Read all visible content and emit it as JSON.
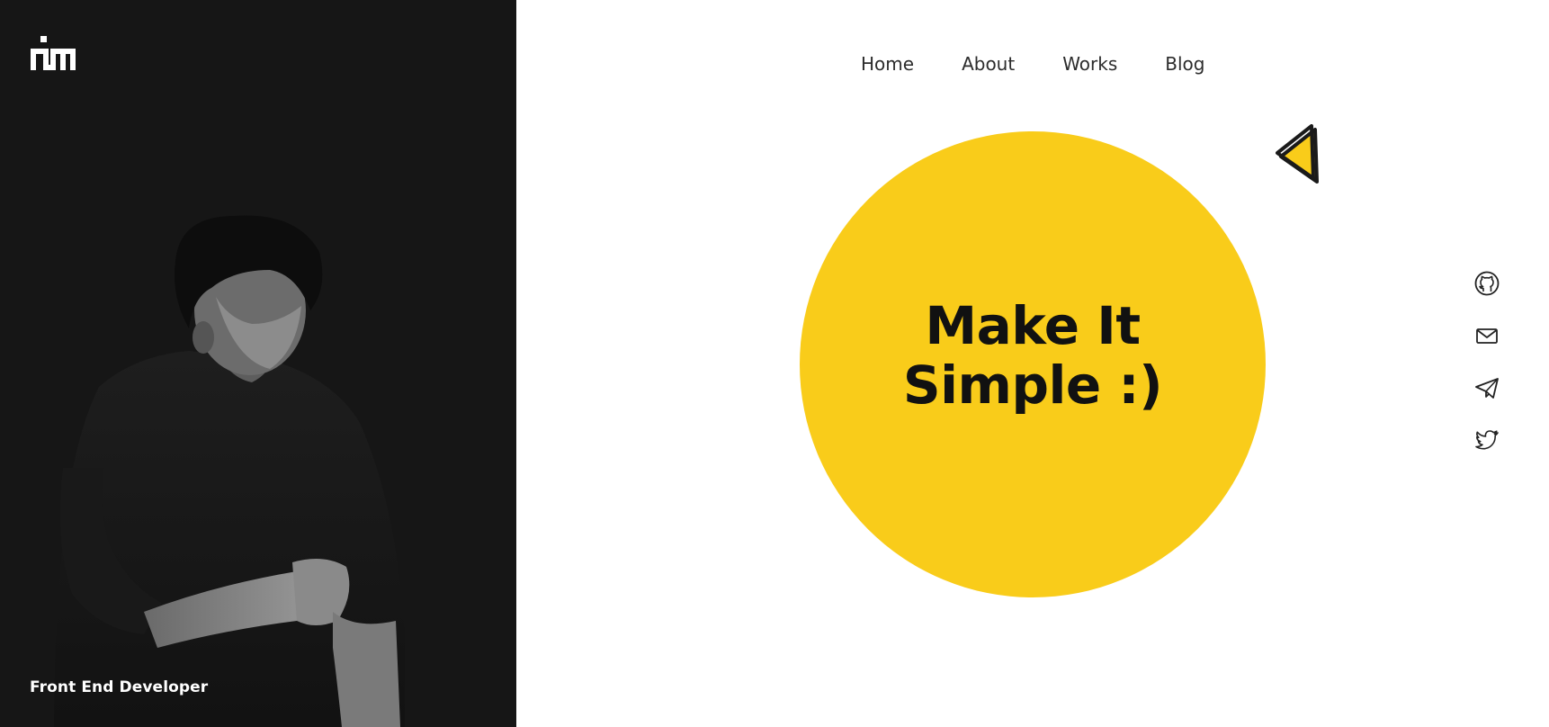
{
  "brand": {
    "logo_icon": "mm-monogram-logo"
  },
  "sidebar": {
    "role": "Front End Developer",
    "background_color": "#161616"
  },
  "nav": {
    "items": [
      {
        "label": "Home",
        "active": true
      },
      {
        "label": "About",
        "active": false
      },
      {
        "label": "Works",
        "active": false
      },
      {
        "label": "Blog",
        "active": false
      }
    ]
  },
  "hero": {
    "title_line1": "Make It",
    "title_line2": "Simple :)",
    "accent_color": "#f9cc1a"
  },
  "socials": [
    {
      "icon": "github-icon"
    },
    {
      "icon": "mail-icon"
    },
    {
      "icon": "telegram-icon"
    },
    {
      "icon": "twitter-icon"
    }
  ]
}
